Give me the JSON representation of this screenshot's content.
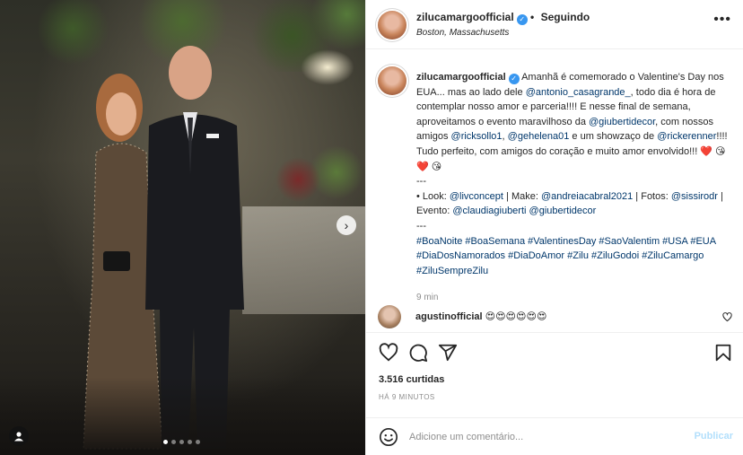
{
  "post": {
    "username": "zilucamargoofficial",
    "follow_separator": "•",
    "follow_status": "Seguindo",
    "location": "Boston, Massachusetts",
    "more_icon": "more-horizontal-icon"
  },
  "caption": {
    "username": "zilucamargoofficial",
    "text_1": "Amanhã é comemorado o Valentine's Day nos EUA... mas ao lado dele ",
    "mention_1": "@antonio_casagrande_",
    "text_2": ", todo dia é hora de contemplar nosso amor e parceria!!!! E nesse final de semana, aproveitamos o evento maravilhoso da ",
    "mention_2": "@giubertidecor",
    "text_3": ", com nossos amigos ",
    "mention_3": "@ricksollo1",
    "text_4": ", ",
    "mention_4": "@gehelena01",
    "text_5": " e um showzaço de ",
    "mention_5": "@rickerenner",
    "text_6": "!!!! Tudo perfeito, com amigos do coração e muito amor envolvido!!! ❤️ 😘 ❤️ 😘",
    "sep_1": "---",
    "text_7": "• Look: ",
    "mention_6": "@livconcept",
    "text_8": " | Make: ",
    "mention_7": "@andreiacabral2021",
    "text_9": " | Fotos: ",
    "mention_8": "@sissirodr",
    "text_10": " | Evento: ",
    "mention_9": "@claudiagiuberti",
    "text_11": " ",
    "mention_10": "@giubertidecor",
    "sep_2": "---",
    "hashtags": "#BoaNoite #BoaSemana #ValentinesDay #SaoValentim #USA #EUA #DiaDosNamorados #DiaDoAmor #Zilu #ZiluGodoi #ZiluCamargo #ZiluSempreZilu",
    "time": "9 min"
  },
  "comment": {
    "username": "agustinofficial",
    "text": "😍😍😍😍😍😍"
  },
  "stats": {
    "likes": "3.516 curtidas",
    "posted_ago": "HÁ 9 MINUTOS"
  },
  "composer": {
    "placeholder": "Adicione um comentário...",
    "publish_label": "Publicar"
  },
  "carousel": {
    "total_slides": 5,
    "active_slide": 1
  },
  "colors": {
    "link": "#00376b",
    "verified": "#3897f0",
    "publish_disabled": "#b2dffc"
  }
}
